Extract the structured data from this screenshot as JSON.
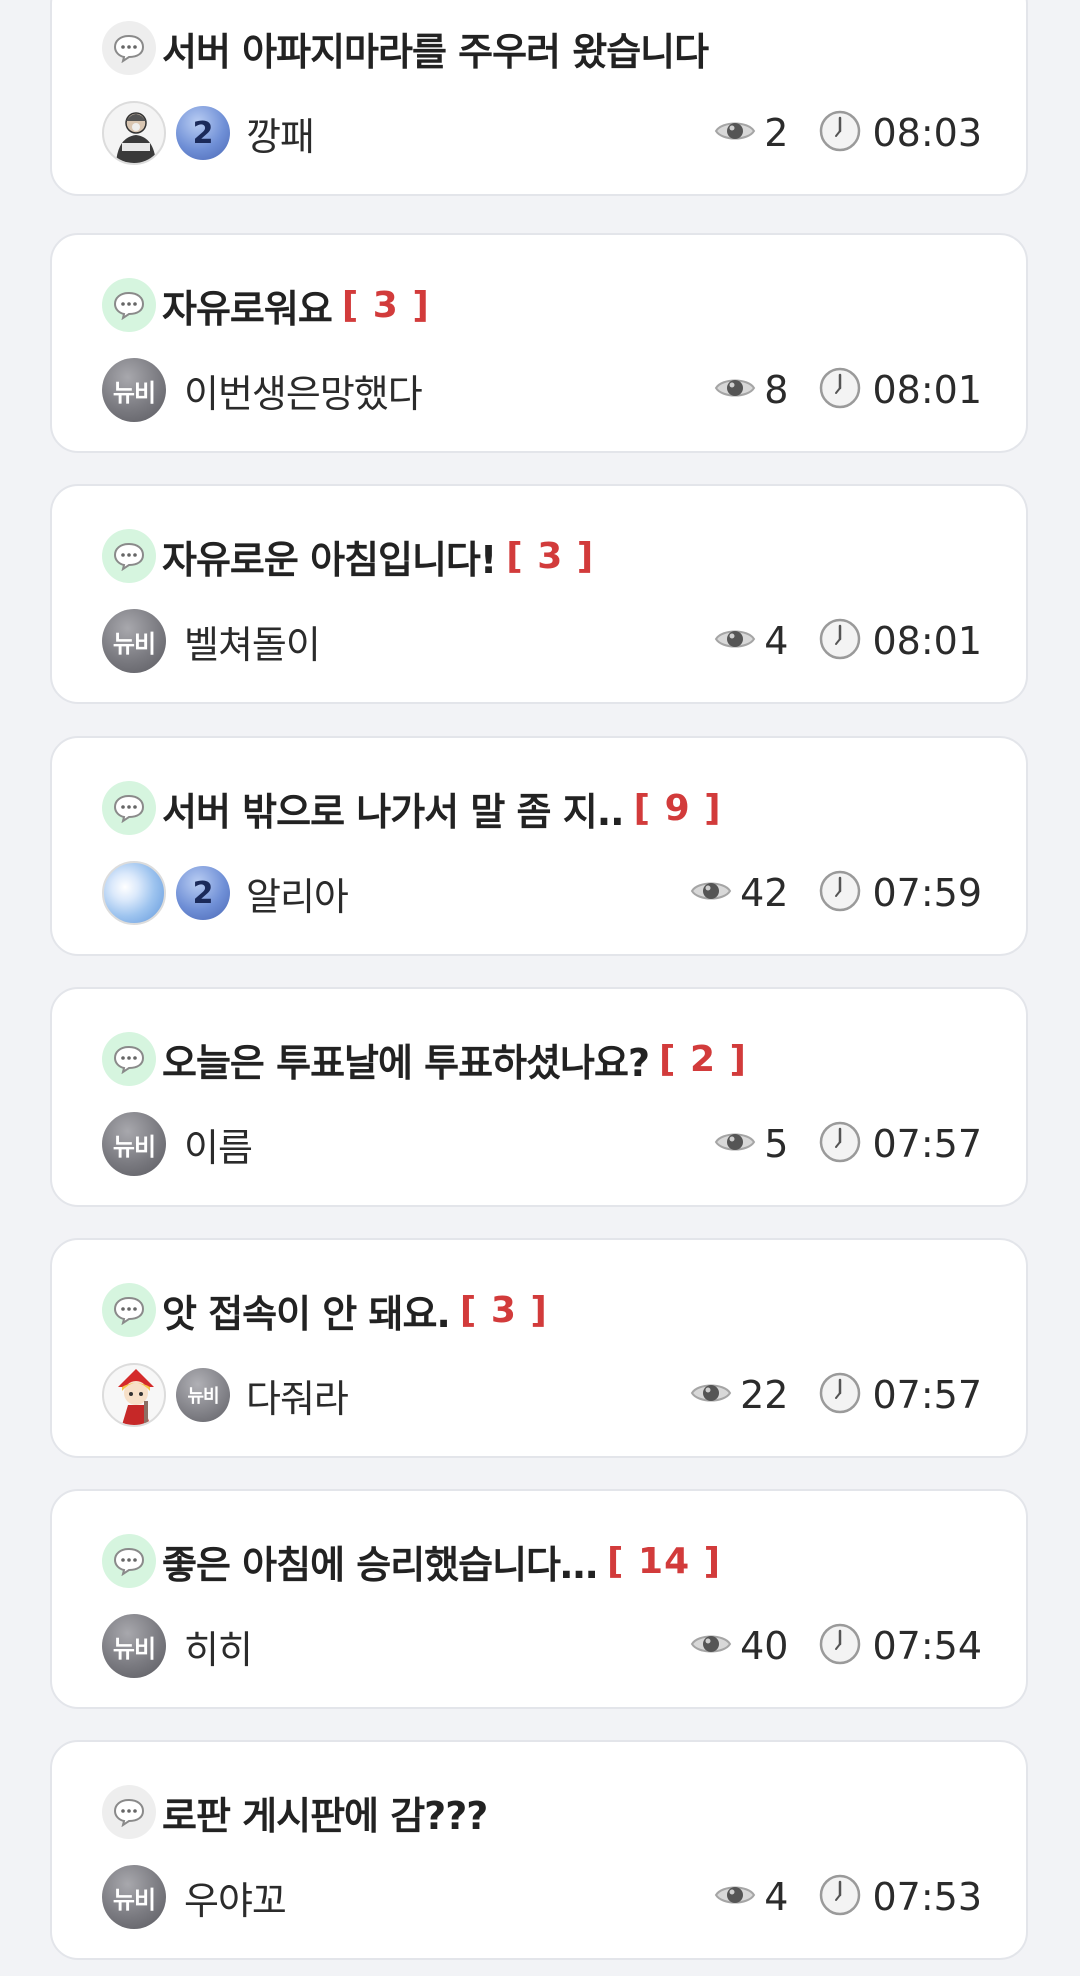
{
  "posts": [
    {
      "title": "서버 아파지마라를 주우러 왔습니다",
      "count": "",
      "author": "깡패",
      "views": "2",
      "time": "08:03",
      "icon": "gray",
      "avatar": "man",
      "avatar_label": "",
      "badge": "2"
    },
    {
      "title": "자유로워요",
      "count": "[ 3 ]",
      "author": "이번생은망했다",
      "views": "8",
      "time": "08:01",
      "icon": "green",
      "avatar": "newbie",
      "avatar_label": "뉴비",
      "badge": ""
    },
    {
      "title": "자유로운 아침입니다!",
      "count": "[ 3 ]",
      "author": "벨쳐돌이",
      "views": "4",
      "time": "08:01",
      "icon": "green",
      "avatar": "newbie",
      "avatar_label": "뉴비",
      "badge": ""
    },
    {
      "title": "서버 밖으로 나가서 말 좀 지..",
      "count": "[ 9 ]",
      "author": "알리아",
      "views": "42",
      "time": "07:59",
      "icon": "green",
      "avatar": "sky",
      "avatar_label": "",
      "badge": "2"
    },
    {
      "title": "오늘은 투표날에 투표하셨나요?",
      "count": "[ 2 ]",
      "author": "이름",
      "views": "5",
      "time": "07:57",
      "icon": "green",
      "avatar": "newbie",
      "avatar_label": "뉴비",
      "badge": ""
    },
    {
      "title": "앗 접속이 안 돼요.",
      "count": "[ 3 ]",
      "author": "다줘라",
      "views": "22",
      "time": "07:57",
      "icon": "green",
      "avatar": "chibi",
      "avatar_label": "",
      "badge": "뉴비"
    },
    {
      "title": "좋은 아침에 승리했습니다…",
      "count": "[ 14 ]",
      "author": "히히",
      "views": "40",
      "time": "07:54",
      "icon": "green",
      "avatar": "newbie",
      "avatar_label": "뉴비",
      "badge": ""
    },
    {
      "title": "로판 게시판에 감???",
      "count": "",
      "author": "우야꼬",
      "views": "4",
      "time": "07:53",
      "icon": "gray",
      "avatar": "newbie",
      "avatar_label": "뉴비",
      "badge": ""
    }
  ],
  "icons": {
    "post": "speech-bubble-icon",
    "views": "eye-icon",
    "time": "clock-icon"
  },
  "colors": {
    "comment_count": "#d23b3b",
    "new_comment_icon_bg": "#d6f5df",
    "read_icon_bg": "#eeeeee",
    "level_badge": "#6f8fd6"
  }
}
